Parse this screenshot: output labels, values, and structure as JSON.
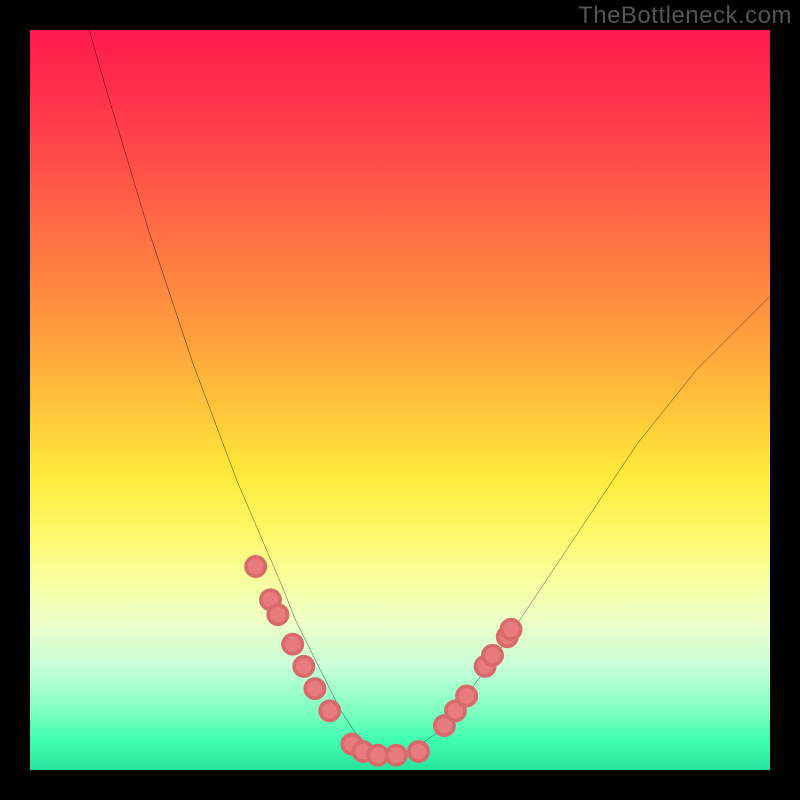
{
  "watermark": "TheBottleneck.com",
  "chart_data": {
    "type": "line",
    "title": "",
    "xlabel": "",
    "ylabel": "",
    "xlim": [
      0,
      100
    ],
    "ylim": [
      0,
      100
    ],
    "grid": false,
    "legend": false,
    "series": [
      {
        "name": "bottleneck-curve",
        "x": [
          8,
          10,
          13,
          16,
          19,
          22,
          25,
          28,
          31,
          34,
          36,
          38,
          40,
          42,
          44,
          46,
          48,
          50,
          52,
          55,
          58,
          62,
          66,
          70,
          74,
          78,
          82,
          86,
          90,
          95,
          100
        ],
        "y": [
          100,
          93,
          83,
          73,
          64,
          55,
          47,
          39,
          32,
          25,
          20,
          16,
          12,
          8,
          5,
          3,
          2,
          2,
          3,
          5,
          9,
          14,
          20,
          26,
          32,
          38,
          44,
          49,
          54,
          59,
          64
        ]
      }
    ],
    "markers": {
      "name": "highlight-dots",
      "x": [
        30.5,
        32.5,
        33.5,
        35.5,
        37.0,
        38.5,
        40.5,
        43.5,
        45.0,
        47.0,
        49.5,
        52.5,
        56.0,
        57.5,
        59.0,
        61.5,
        62.5,
        64.5,
        65.0
      ],
      "y": [
        27.5,
        23.0,
        21.0,
        17.0,
        14.0,
        11.0,
        8.0,
        3.5,
        2.5,
        2.0,
        2.0,
        2.5,
        6.0,
        8.0,
        10.0,
        14.0,
        15.5,
        18.0,
        19.0
      ]
    }
  }
}
